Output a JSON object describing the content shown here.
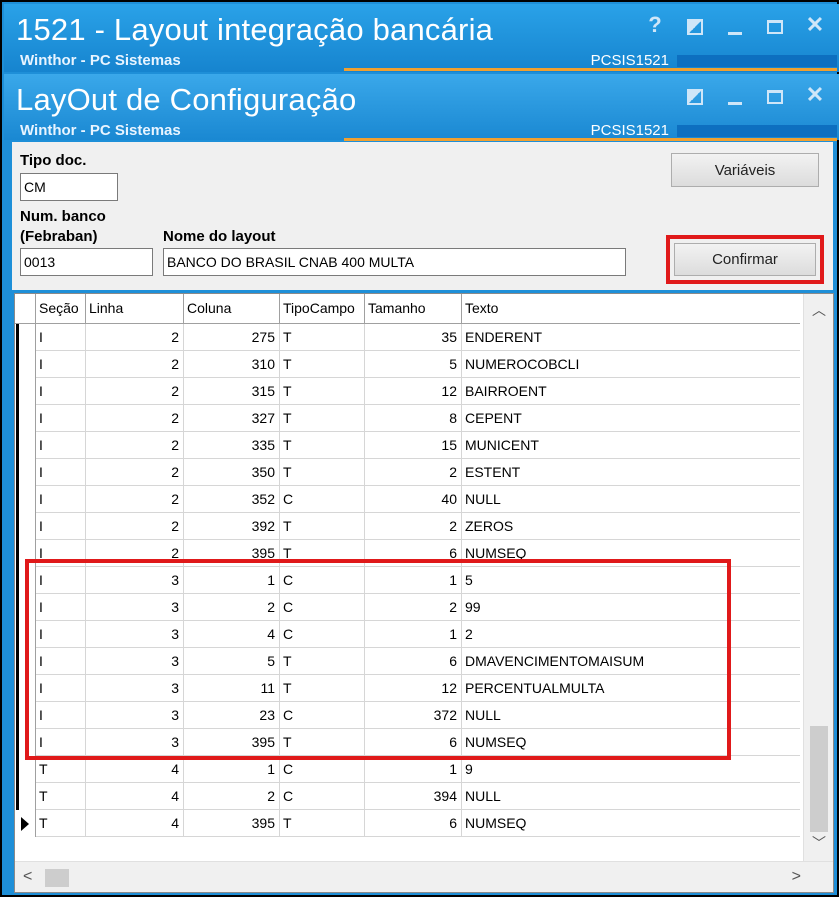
{
  "window": {
    "title": "1521 - Layout integração bancária",
    "subtitle": "Winthor - PC Sistemas",
    "code": "PCSIS1521"
  },
  "dialog": {
    "title": "LayOut de Configuração",
    "subtitle": "Winthor - PC Sistemas",
    "code": "PCSIS1521"
  },
  "controls": {
    "help": "?",
    "close": "✕"
  },
  "form": {
    "tipo_doc_label": "Tipo doc.",
    "tipo_doc_value": "CM",
    "num_banco_label_1": "Num. banco",
    "num_banco_label_2": "(Febraban)",
    "num_banco_value": "0013",
    "nome_layout_label": "Nome do layout",
    "nome_layout_value": "BANCO DO BRASIL CNAB 400  MULTA",
    "variaveis_button": "Variáveis",
    "confirmar_button": "Confirmar"
  },
  "accent": {
    "highlight": "#e0191a",
    "titlebar": "#1e8fd8"
  },
  "grid": {
    "columns": [
      "Seção",
      "Linha",
      "Coluna",
      "TipoCampo",
      "Tamanho",
      "Texto"
    ],
    "rows": [
      [
        "I",
        "2",
        "275",
        "T",
        "35",
        "ENDERENT"
      ],
      [
        "I",
        "2",
        "310",
        "T",
        "5",
        "NUMEROCOBCLI"
      ],
      [
        "I",
        "2",
        "315",
        "T",
        "12",
        "BAIRROENT"
      ],
      [
        "I",
        "2",
        "327",
        "T",
        "8",
        "CEPENT"
      ],
      [
        "I",
        "2",
        "335",
        "T",
        "15",
        "MUNICENT"
      ],
      [
        "I",
        "2",
        "350",
        "T",
        "2",
        "ESTENT"
      ],
      [
        "I",
        "2",
        "352",
        "C",
        "40",
        "NULL"
      ],
      [
        "I",
        "2",
        "392",
        "T",
        "2",
        "ZEROS"
      ],
      [
        "I",
        "2",
        "395",
        "T",
        "6",
        "NUMSEQ"
      ],
      [
        "I",
        "3",
        "1",
        "C",
        "1",
        "5"
      ],
      [
        "I",
        "3",
        "2",
        "C",
        "2",
        "99"
      ],
      [
        "I",
        "3",
        "4",
        "C",
        "1",
        "2"
      ],
      [
        "I",
        "3",
        "5",
        "T",
        "6",
        "DMAVENCIMENTOMAISUM"
      ],
      [
        "I",
        "3",
        "11",
        "T",
        "12",
        "PERCENTUALMULTA"
      ],
      [
        "I",
        "3",
        "23",
        "C",
        "372",
        "NULL"
      ],
      [
        "I",
        "3",
        "395",
        "T",
        "6",
        "NUMSEQ"
      ],
      [
        "T",
        "4",
        "1",
        "C",
        "1",
        "9"
      ],
      [
        "T",
        "4",
        "2",
        "C",
        "394",
        "NULL"
      ],
      [
        "T",
        "4",
        "395",
        "T",
        "6",
        "NUMSEQ"
      ]
    ],
    "current_row": 18
  }
}
